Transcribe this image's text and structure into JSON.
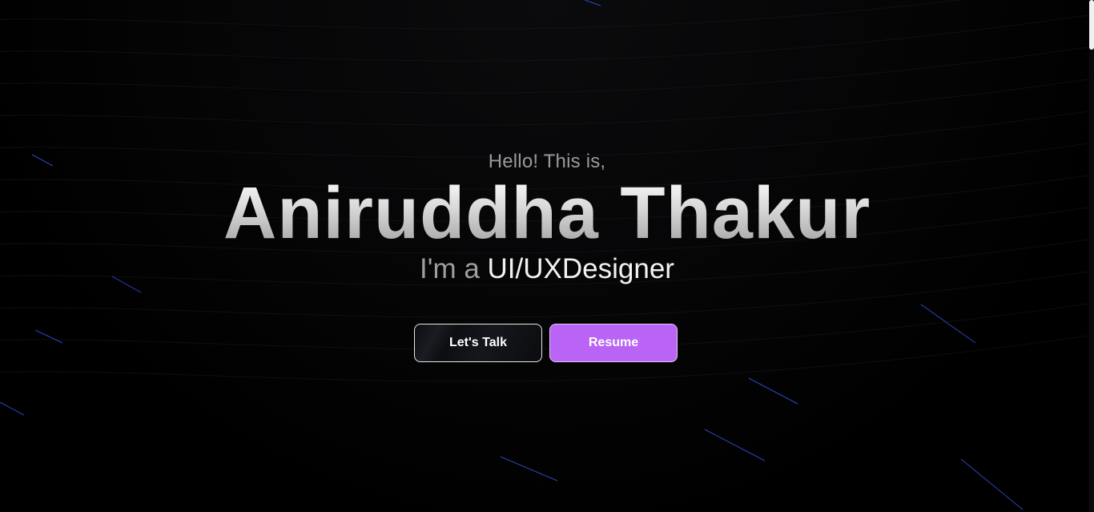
{
  "hero": {
    "greeting": "Hello! This is,",
    "name": "Aniruddha Thakur",
    "role_prefix": "I'm a",
    "role_title": "UI/UXDesigner"
  },
  "actions": {
    "talk_label": "Let's Talk",
    "resume_label": "Resume"
  },
  "colors": {
    "background": "#000000",
    "accent": "#b964f5",
    "streak": "#3b5bff"
  }
}
